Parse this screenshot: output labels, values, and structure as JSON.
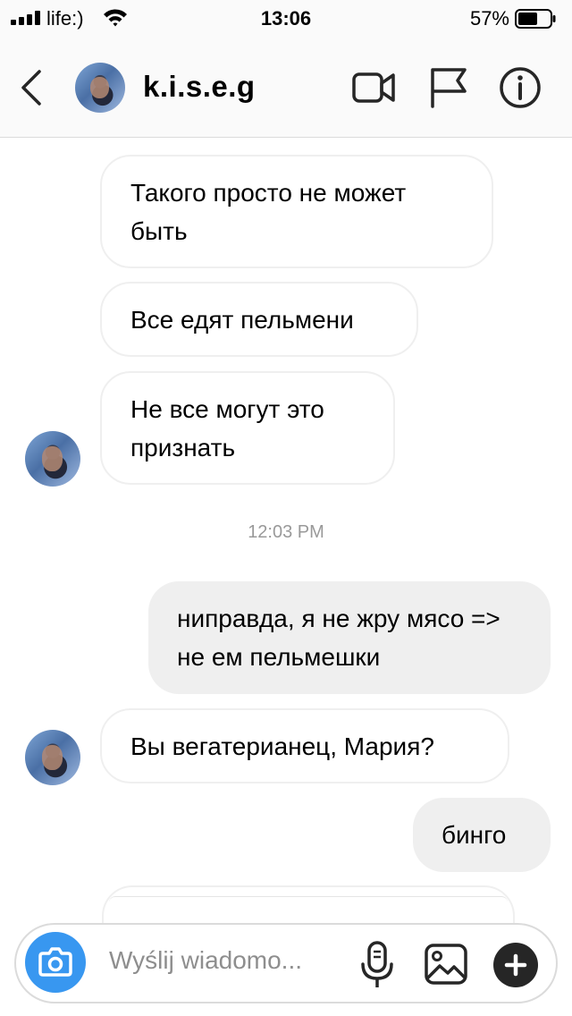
{
  "status_bar": {
    "carrier": "life:)",
    "time": "13:06",
    "battery": "57%"
  },
  "header": {
    "username": "k.i.s.e.g"
  },
  "messages": [
    {
      "direction": "incoming",
      "text": "Такого просто не может быть"
    },
    {
      "direction": "incoming",
      "text": "Все едят пельмени"
    },
    {
      "direction": "incoming",
      "text": "Не все могут это признать"
    },
    {
      "direction": "outgoing",
      "text": "ниправда, я не жру мясо => не ем пельмешки"
    },
    {
      "direction": "incoming",
      "text": "Вы вегатерианец, Мария?"
    },
    {
      "direction": "outgoing",
      "text": "бинго"
    }
  ],
  "timestamp": "12:03 PM",
  "composer": {
    "placeholder": "Wyślij wiadomo..."
  },
  "colors": {
    "accent_blue": "#3897f0",
    "outgoing_bubble": "#efefef",
    "incoming_border": "#efefef",
    "timestamp_gray": "#999999"
  },
  "icons": [
    "back-chevron-icon",
    "video-camera-icon",
    "flag-icon",
    "info-icon",
    "camera-icon",
    "microphone-icon",
    "gallery-icon",
    "plus-icon"
  ]
}
